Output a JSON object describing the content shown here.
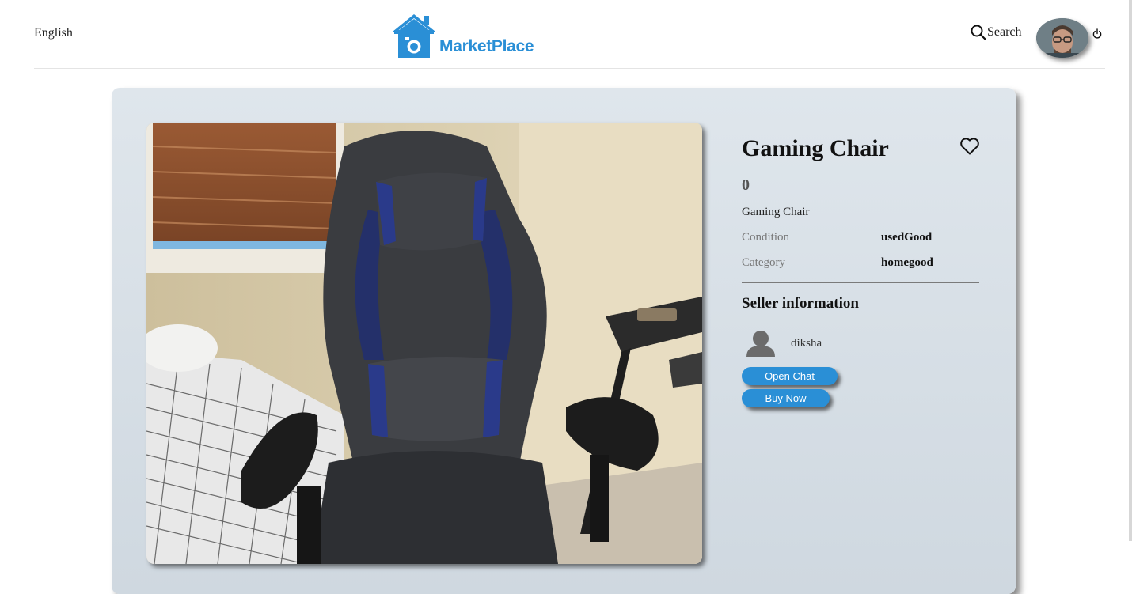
{
  "header": {
    "language": "English",
    "logo_text": "MarketPlace",
    "search_label": "Search"
  },
  "product": {
    "title": "Gaming Chair",
    "price": "0",
    "description": "Gaming Chair",
    "condition_label": "Condition",
    "condition_value": "usedGood",
    "category_label": "Category",
    "category_value": "homegood"
  },
  "seller": {
    "heading": "Seller information",
    "name": "diksha"
  },
  "actions": {
    "open_chat": "Open Chat",
    "buy_now": "Buy Now"
  },
  "colors": {
    "brand": "#2a8fd6",
    "card_bg": "#dae2e8"
  },
  "icons": [
    "house-camera-logo-icon",
    "search-icon",
    "power-icon",
    "heart-icon",
    "user-silhouette-icon"
  ]
}
